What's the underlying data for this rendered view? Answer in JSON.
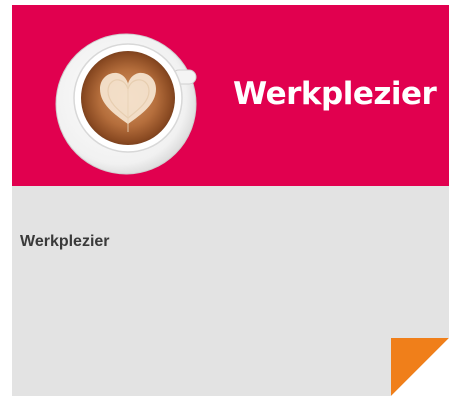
{
  "tile": {
    "banner_title": "Werkplezier",
    "title": "Werkplezier",
    "image_icon": "latte-art-heart-coffee-cup",
    "corner_icon": "folded-corner-triangle"
  },
  "colors": {
    "banner": "#e1004f",
    "card_background": "#e3e3e3",
    "corner_accent": "#f07f1a",
    "title_text": "#3a3a3a",
    "banner_text": "#ffffff"
  }
}
